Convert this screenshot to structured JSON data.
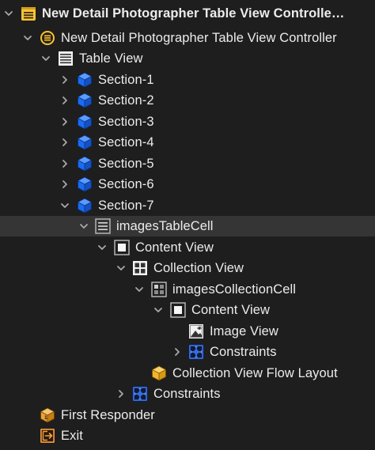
{
  "outline": {
    "rows": [
      {
        "label": "New Detail Photographer Table View Controlle…",
        "icon": "scene-icon",
        "disclosure": "expanded"
      },
      {
        "label": "New Detail Photographer Table View Controller",
        "icon": "view-controller-icon",
        "disclosure": "expanded"
      },
      {
        "label": "Table View",
        "icon": "table-view-icon",
        "disclosure": "expanded"
      },
      {
        "label": "Section-1",
        "icon": "section-cube-icon",
        "disclosure": "collapsed"
      },
      {
        "label": "Section-2",
        "icon": "section-cube-icon",
        "disclosure": "collapsed"
      },
      {
        "label": "Section-3",
        "icon": "section-cube-icon",
        "disclosure": "collapsed"
      },
      {
        "label": "Section-4",
        "icon": "section-cube-icon",
        "disclosure": "collapsed"
      },
      {
        "label": "Section-5",
        "icon": "section-cube-icon",
        "disclosure": "collapsed"
      },
      {
        "label": "Section-6",
        "icon": "section-cube-icon",
        "disclosure": "collapsed"
      },
      {
        "label": "Section-7",
        "icon": "section-cube-icon",
        "disclosure": "expanded"
      },
      {
        "label": "imagesTableCell",
        "icon": "table-cell-icon",
        "disclosure": "expanded",
        "selected": true
      },
      {
        "label": "Content View",
        "icon": "content-view-icon",
        "disclosure": "expanded"
      },
      {
        "label": "Collection View",
        "icon": "collection-view-icon",
        "disclosure": "expanded"
      },
      {
        "label": "imagesCollectionCell",
        "icon": "collection-cell-icon",
        "disclosure": "expanded"
      },
      {
        "label": "Content View",
        "icon": "content-view-icon",
        "disclosure": "expanded"
      },
      {
        "label": "Image View",
        "icon": "image-view-icon",
        "disclosure": "none"
      },
      {
        "label": "Constraints",
        "icon": "constraints-icon",
        "disclosure": "collapsed"
      },
      {
        "label": "Collection View Flow Layout",
        "icon": "flow-layout-cube-icon",
        "disclosure": "none"
      },
      {
        "label": "Constraints",
        "icon": "constraints-icon",
        "disclosure": "collapsed"
      },
      {
        "label": "First Responder",
        "icon": "first-responder-icon",
        "disclosure": "none"
      },
      {
        "label": "Exit",
        "icon": "exit-icon",
        "disclosure": "none"
      }
    ]
  },
  "colors": {
    "background": "#1e1e1e",
    "selected_row": "#353535",
    "text": "#ececec",
    "disclosure": "#a8a8a8",
    "scene_yellow": "#f5c33b",
    "section_blue": "#1a6cf2",
    "constraint_blue": "#2f6cf0",
    "flow_layout_yellow": "#f1b62d",
    "first_responder_orange": "#e8a23a",
    "exit_orange": "#e8913a"
  }
}
